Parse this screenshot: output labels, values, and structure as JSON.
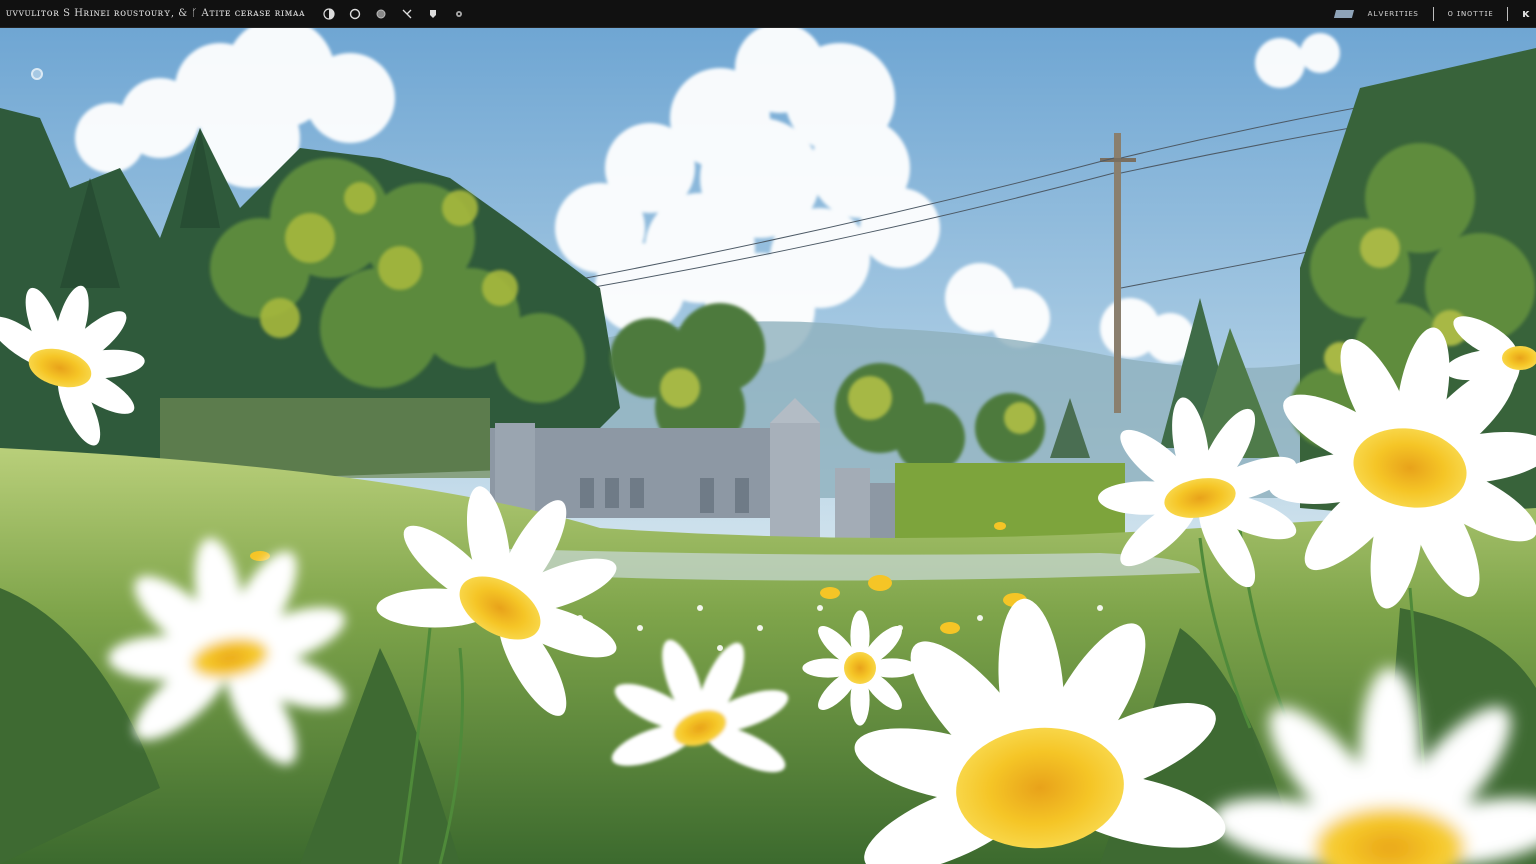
{
  "header": {
    "title": "ᴜᴠᴠᴜʟɪᴛᴏʀ Ѕ Hʀɪɴᴇɪ ʀᴏᴜѕᴛᴏᴜʀʏ, & ᚴ Aᴛɪᴛᴇ ᴄᴇʀᴀѕᴇ ʀɪᴍᴀᴀ",
    "right_label_1": "ᴀʟᴠᴇʀɪᴛɪᴇѕ",
    "right_label_2": "ᴏ ɪɴᴏᴛᴛɪᴇ",
    "right_label_3": "ᴋ"
  },
  "icons": [
    "contrast-icon",
    "circle-icon",
    "dot-icon",
    "arrows-icon",
    "brush-icon",
    "settings-icon"
  ],
  "colors": {
    "sky_top": "#7fb2d9",
    "sky_bottom": "#cfe3ef",
    "foliage_dark": "#3f6b3c",
    "foliage_light": "#9bb63f",
    "meadow": "#7fa94a",
    "petal": "#ffffff",
    "center": "#f2c22a"
  }
}
